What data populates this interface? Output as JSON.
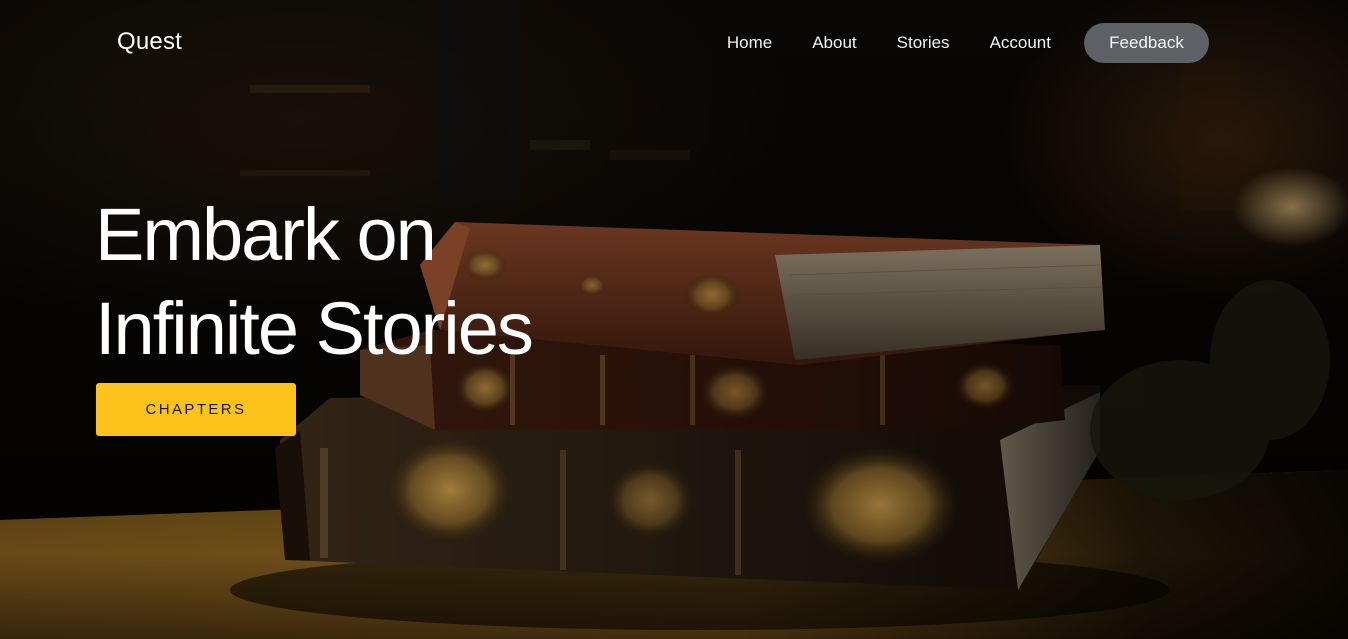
{
  "brand": {
    "name": "Quest"
  },
  "nav": {
    "links": [
      {
        "label": "Home"
      },
      {
        "label": "About"
      },
      {
        "label": "Stories"
      },
      {
        "label": "Account"
      }
    ],
    "feedback_label": "Feedback"
  },
  "hero": {
    "headline_line1": "Embark on",
    "headline_line2": "Infinite Stories",
    "cta_label": "CHAPTERS",
    "background_image": "stack-of-antique-books-on-wooden-table"
  },
  "colors": {
    "accent": "#fdc31c",
    "nav_pill": "#5d6166",
    "text": "#ffffff",
    "background": "#050302"
  }
}
